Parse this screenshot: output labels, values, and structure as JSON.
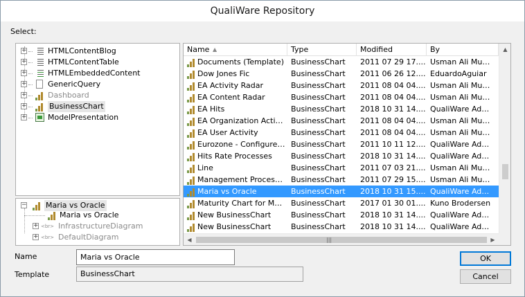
{
  "window": {
    "title": "QualiWare Repository"
  },
  "select_label": "Select:",
  "top_tree": [
    {
      "label": "HTMLContentBlog",
      "icon": "html-list-icon",
      "muted": false
    },
    {
      "label": "HTMLContentTable",
      "icon": "html-table-icon",
      "muted": false
    },
    {
      "label": "HTMLEmbeddedContent",
      "icon": "html-embed-icon",
      "muted": false
    },
    {
      "label": "GenericQuery",
      "icon": "document-icon",
      "muted": false
    },
    {
      "label": "Dashboard",
      "icon": "chart-icon",
      "muted": true
    },
    {
      "label": "BusinessChart",
      "icon": "chart-icon",
      "muted": false
    },
    {
      "label": "ModelPresentation",
      "icon": "presentation-icon",
      "muted": false
    }
  ],
  "bottom_tree": {
    "root": "Maria vs Oracle",
    "child": "Maria vs Oracle",
    "items": [
      "InfrastructureDiagram",
      "DefaultDiagram"
    ],
    "tag": "<br>"
  },
  "list": {
    "columns": [
      "Name",
      "Type",
      "Modified",
      "By"
    ],
    "rows": [
      [
        "Documents (Template)",
        "BusinessChart",
        "2011 07 29 17....",
        "Usman Ali Muna..."
      ],
      [
        "Dow Jones Fic",
        "BusinessChart",
        "2011 06 26 12....",
        "EduardoAguiar"
      ],
      [
        "EA Activity Radar",
        "BusinessChart",
        "2011 08 04 04....",
        "Usman Ali Muna..."
      ],
      [
        "EA Content Radar",
        "BusinessChart",
        "2011 08 04 04....",
        "Usman Ali Muna..."
      ],
      [
        "EA Hits",
        "BusinessChart",
        "2018 10 31 14....",
        "QualiWare Admi..."
      ],
      [
        "EA Organization Activity",
        "BusinessChart",
        "2011 08 04 04....",
        "Usman Ali Muna..."
      ],
      [
        "EA User Activity",
        "BusinessChart",
        "2011 08 04 04....",
        "Usman Ali Muna..."
      ],
      [
        "Eurozone - Configured ...",
        "BusinessChart",
        "2011 10 11 12....",
        "QualiWare Admi..."
      ],
      [
        "Hits Rate Processes",
        "BusinessChart",
        "2018 10 31 14....",
        "QualiWare Admi..."
      ],
      [
        "Line",
        "BusinessChart",
        "2011 07 03 21....",
        "Usman Ali Muna..."
      ],
      [
        "Management Processes",
        "BusinessChart",
        "2011 07 29 15....",
        "Usman Ali Muna..."
      ],
      [
        "Maria vs Oracle",
        "BusinessChart",
        "2018 10 31 15....",
        "QualiWare Admi..."
      ],
      [
        "Maturity Chart for Mark...",
        "BusinessChart",
        "2017 01 30 01....",
        "Kuno Brodersen"
      ],
      [
        "New BusinessChart",
        "BusinessChart",
        "2018 10 31 14....",
        "QualiWare Admi..."
      ],
      [
        "New BusinessChart",
        "BusinessChart",
        "2018 10 31 14....",
        "QualiWare Admi..."
      ]
    ],
    "selected_index": 11,
    "sort_column": "Name",
    "sort_direction": "ascending"
  },
  "fields": {
    "name_label": "Name",
    "name_value": "Maria vs Oracle",
    "template_label": "Template",
    "template_value": "BusinessChart"
  },
  "buttons": {
    "ok": "OK",
    "cancel": "Cancel"
  },
  "colors": {
    "selection": "#3399ff",
    "chart_bar": "#b08a2e"
  }
}
